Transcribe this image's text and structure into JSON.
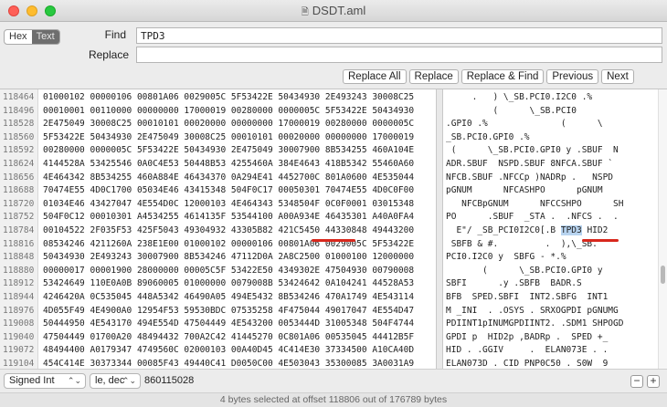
{
  "window": {
    "title": "DSDT.aml"
  },
  "mode": {
    "hex_label": "Hex",
    "text_label": "Text"
  },
  "find": {
    "label": "Find",
    "value": "TPD3"
  },
  "replace": {
    "label": "Replace",
    "value": ""
  },
  "buttons": {
    "replace_all": "Replace All",
    "replace": "Replace",
    "replace_find": "Replace & Find",
    "previous": "Previous",
    "next": "Next"
  },
  "rows": [
    {
      "offset": "118464",
      "hex": "01000102 00000106 00801A06 0029005C 5F53422E 50434930 2E493243 30008C25",
      "text": "     .   ) \\_SB.PCI0.I2C0 .%"
    },
    {
      "offset": "118496",
      "hex": "00010001 00110000 00000000 17000019 00280000 0000005C 5F53422E 50434930",
      "text": "         (      \\_SB.PCI0"
    },
    {
      "offset": "118528",
      "hex": "2E475049 30008C25 00010101 00020000 00000000 17000019 00280000 0000005C",
      "text": ".GPI0 .%              (      \\"
    },
    {
      "offset": "118560",
      "hex": "5F53422E 50434930 2E475049 30008C25 00010101 00020000 00000000 17000019",
      "text": "_SB.PCI0.GPI0 .%"
    },
    {
      "offset": "118592",
      "hex": "00280000 0000005C 5F53422E 50434930 2E475049 30007900 8B534255 460A104E",
      "text": " (      \\_SB.PCI0.GPI0 y .SBUF  N"
    },
    {
      "offset": "118624",
      "hex": "4144528A 53425546 0A0C4E53 50448B53 4255460A 384E4643 418B5342 55460A60",
      "text": "ADR.SBUF  NSPD.SBUF 8NFCA.SBUF `"
    },
    {
      "offset": "118656",
      "hex": "4E464342 8B534255 460A884E 46434370 0A294E41 4452700C 801A0600 4E535044",
      "text": "NFCB.SBUF .NFCCp )NADRp .   NSPD"
    },
    {
      "offset": "118688",
      "hex": "70474E55 4D0C1700 05034E46 43415348 504F0C17 00050301 70474E55 4D0C0F00",
      "text": "pGNUM      NFCASHPO      pGNUM"
    },
    {
      "offset": "118720",
      "hex": "01034E46 43427047 4E554D0C 12000103 4E464343 5348504F 0C0F0001 03015348",
      "text": "   NFCBpGNUM      NFCCSHPO      SH"
    },
    {
      "offset": "118752",
      "hex": "504F0C12 00010301 A4534255 4614135F 53544100 A00A934E 46435301 A40A0FA4",
      "text": "PO      .SBUF  _STA .  .NFCS .  ."
    },
    {
      "offset": "118784",
      "hex": "00104522 2F035F53 425F5043 49304932 43305B82 421C5450 44330848 49443200",
      "text": "  E\"/ _SB_PCI0I2C0[.B TPD3 HID2"
    },
    {
      "offset": "118816",
      "hex": "08534246 4211260A 238E1E00 01000102 00000106 00801A06 0029005C 5F53422E",
      "text": " SBFB & #.         .  ),\\_SB."
    },
    {
      "offset": "118848",
      "hex": "50434930 2E493243 30007900 8B534246 47112D0A 2A8C2500 01000100 12000000",
      "text": "PCI0.I2C0 y  SBFG - *.%"
    },
    {
      "offset": "118880",
      "hex": "00000017 00001900 28000000 00005C5F 53422E50 4349302E 47504930 00790008",
      "text": "       (      \\_SB.PCI0.GPI0 y"
    },
    {
      "offset": "118912",
      "hex": "53424649 110E0A0B 89060005 01000000 0079008B 53424642 0A104241 44528A53",
      "text": "SBFI      .y .SBFB  BADR.S"
    },
    {
      "offset": "118944",
      "hex": "4246420A 0C535045 448A5342 46490A05 494E5432 8B534246 470A1749 4E543114",
      "text": "BFB  SPED.SBFI  INT2.SBFG  INT1"
    },
    {
      "offset": "118976",
      "hex": "4D055F49 4E4900A0 12954F53 59530BDC 07535258 4F475044 49017047 4E554D47",
      "text": "M _INI  . .OSYS . SRXOGPDI pGNUMG"
    },
    {
      "offset": "119008",
      "hex": "50444950 4E543170 494E554D 47504449 4E543200 0053444D 31005348 504F4744",
      "text": "PDIINT1pINUMGPDIINT2. .SDM1 SHPOGD"
    },
    {
      "offset": "119040",
      "hex": "47504449 01700A20 48494432 700A2C42 41445270 0C801A06 00535045 44412B5F",
      "text": "GPDI p  HID2p ,BADRp .  SPED +_"
    },
    {
      "offset": "119072",
      "hex": "48494400 A0179347 4749560C 02000103 00A40D45 4C414E30 37334500 A10CA40D",
      "text": "HID . .GGIV     .  ELAN073E . ."
    },
    {
      "offset": "119104",
      "hex": "454C414E 30373344 00085F43 49440C41 D0050C00 4E503043 35300085 3A0031A9",
      "text": "ELAN073D . CID PNP0C50 . S0W  9"
    }
  ],
  "bottom": {
    "type_select": "Signed Int",
    "endian_select": "le, dec",
    "value": "860115028",
    "minus": "−",
    "plus": "+"
  },
  "status": "4 bytes selected at offset 118806 out of 176789 bytes"
}
